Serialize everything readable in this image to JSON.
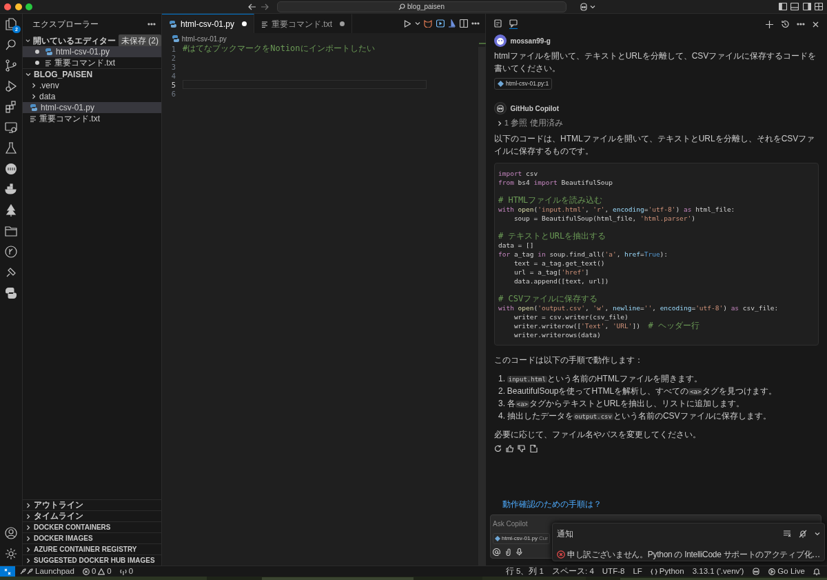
{
  "title_bar": {
    "search": "blog_paisen"
  },
  "activity_bar": {
    "explorer_badge": "2"
  },
  "sidebar": {
    "title": "エクスプローラー",
    "sections": [
      {
        "kind": "open_editors",
        "title": "開いているエディター",
        "expanded": true,
        "badge": "未保存 (2)",
        "items": [
          {
            "kind": "py",
            "label": "html-csv-01.py",
            "modified": true,
            "selected": true
          },
          {
            "kind": "txt",
            "label": "重要コマンド.txt",
            "modified": true,
            "selected": false
          }
        ]
      },
      {
        "kind": "folder",
        "title": "BLOG_PAISEN",
        "expanded": true,
        "items": [
          {
            "kind": "dir",
            "label": ".venv",
            "expanded": false,
            "selected": false
          },
          {
            "kind": "dir",
            "label": "data",
            "expanded": false,
            "selected": false
          },
          {
            "kind": "py",
            "label": "html-csv-01.py",
            "selected": true
          },
          {
            "kind": "txt",
            "label": "重要コマンド.txt",
            "selected": false
          }
        ]
      }
    ],
    "collapsed_sections": [
      {
        "title": "アウトライン",
        "expanded": false
      },
      {
        "title": "タイムライン",
        "expanded": false
      },
      {
        "title": "DOCKER CONTAINERS",
        "expanded": false
      },
      {
        "title": "DOCKER IMAGES",
        "expanded": false
      },
      {
        "title": "AZURE CONTAINER REGISTRY",
        "expanded": false
      },
      {
        "title": "SUGGESTED DOCKER HUB IMAGES",
        "expanded": false
      }
    ]
  },
  "editor": {
    "tabs": [
      {
        "kind": "py",
        "label": "html-csv-01.py",
        "modified": true,
        "selected": true
      },
      {
        "kind": "txt",
        "label": "重要コマンド.txt",
        "modified": true,
        "selected": false
      }
    ],
    "breadcrumb": "html-csv-01.py",
    "lines": [
      {
        "number": "1",
        "text": "#はてなブックマークをNotionにインポートしたい",
        "current": false
      },
      {
        "number": "2",
        "current": false
      },
      {
        "number": "3",
        "current": false
      },
      {
        "number": "4",
        "current": false
      },
      {
        "number": "5",
        "current": true
      },
      {
        "number": "6",
        "current": false
      }
    ]
  },
  "chat": {
    "tabs": [
      {
        "selected": false
      },
      {
        "selected": true
      }
    ],
    "user": {
      "name": "mossan99-g",
      "text": "htmlファイルを開いて、テキストとURLを分離して、CSVファイルに保存するコードを書いてください。",
      "reference": "html-csv-01.py:1"
    },
    "copilot": {
      "name": "GitHub Copilot",
      "references": "1 参照 使用済み",
      "references_expanded": false,
      "intro": "以下のコードは、HTMLファイルを開いて、テキストとURLを分離し、それをCSVファイルに保存するものです。",
      "code": [
        [
          [
            {
              "kind": "keyword",
              "text": "import "
            },
            {
              "kind": "plain",
              "text": "csv"
            }
          ],
          [
            {
              "kind": "keyword",
              "text": "from "
            },
            {
              "kind": "plain",
              "text": "bs4 "
            },
            {
              "kind": "keyword",
              "text": "import "
            },
            {
              "kind": "plain",
              "text": "BeautifulSoup"
            }
          ]
        ],
        [
          [
            {
              "kind": "comment",
              "text": "# HTMLファイルを読み込む"
            }
          ],
          [
            {
              "kind": "keyword",
              "text": "with "
            },
            {
              "kind": "function",
              "text": "open"
            },
            {
              "kind": "plain",
              "text": "("
            },
            {
              "kind": "string",
              "text": "'input.html'"
            },
            {
              "kind": "plain",
              "text": ", "
            },
            {
              "kind": "string",
              "text": "'r'"
            },
            {
              "kind": "plain",
              "text": ", "
            },
            {
              "kind": "param",
              "text": "encoding"
            },
            {
              "kind": "plain",
              "text": "="
            },
            {
              "kind": "string",
              "text": "'utf-8'"
            },
            {
              "kind": "plain",
              "text": ") "
            },
            {
              "kind": "keyword",
              "text": "as "
            },
            {
              "kind": "plain",
              "text": "html_file:"
            }
          ],
          [
            {
              "kind": "plain",
              "text": "    soup = BeautifulSoup(html_file, "
            },
            {
              "kind": "string",
              "text": "'html.parser'"
            },
            {
              "kind": "plain",
              "text": ")"
            }
          ]
        ],
        [
          [
            {
              "kind": "comment",
              "text": "# テキストとURLを抽出する"
            }
          ],
          [
            {
              "kind": "plain",
              "text": "data = []"
            }
          ],
          [
            {
              "kind": "keyword",
              "text": "for "
            },
            {
              "kind": "plain",
              "text": "a_tag "
            },
            {
              "kind": "keyword",
              "text": "in "
            },
            {
              "kind": "plain",
              "text": "soup.find_all("
            },
            {
              "kind": "string",
              "text": "'a'"
            },
            {
              "kind": "plain",
              "text": ", "
            },
            {
              "kind": "param",
              "text": "href"
            },
            {
              "kind": "plain",
              "text": "="
            },
            {
              "kind": "constant",
              "text": "True"
            },
            {
              "kind": "plain",
              "text": "):"
            }
          ],
          [
            {
              "kind": "plain",
              "text": "    text = a_tag.get_text()"
            }
          ],
          [
            {
              "kind": "plain",
              "text": "    url = a_tag["
            },
            {
              "kind": "string",
              "text": "'href'"
            },
            {
              "kind": "plain",
              "text": "]"
            }
          ],
          [
            {
              "kind": "plain",
              "text": "    data.append([text, url])"
            }
          ]
        ],
        [
          [
            {
              "kind": "comment",
              "text": "# CSVファイルに保存する"
            }
          ],
          [
            {
              "kind": "keyword",
              "text": "with "
            },
            {
              "kind": "function",
              "text": "open"
            },
            {
              "kind": "plain",
              "text": "("
            },
            {
              "kind": "string",
              "text": "'output.csv'"
            },
            {
              "kind": "plain",
              "text": ", "
            },
            {
              "kind": "string",
              "text": "'w'"
            },
            {
              "kind": "plain",
              "text": ", "
            },
            {
              "kind": "param",
              "text": "newline"
            },
            {
              "kind": "plain",
              "text": "="
            },
            {
              "kind": "string",
              "text": "''"
            },
            {
              "kind": "plain",
              "text": ", "
            },
            {
              "kind": "param",
              "text": "encoding"
            },
            {
              "kind": "plain",
              "text": "="
            },
            {
              "kind": "string",
              "text": "'utf-8'"
            },
            {
              "kind": "plain",
              "text": ") "
            },
            {
              "kind": "keyword",
              "text": "as "
            },
            {
              "kind": "plain",
              "text": "csv_file:"
            }
          ],
          [
            {
              "kind": "plain",
              "text": "    writer = csv.writer(csv_file)"
            }
          ],
          [
            {
              "kind": "plain",
              "text": "    writer.writerow(["
            },
            {
              "kind": "string",
              "text": "'Text'"
            },
            {
              "kind": "plain",
              "text": ", "
            },
            {
              "kind": "string",
              "text": "'URL'"
            },
            {
              "kind": "plain",
              "text": "])  "
            },
            {
              "kind": "comment",
              "text": "# ヘッダー行"
            }
          ],
          [
            {
              "kind": "plain",
              "text": "    writer.writerows(data)"
            }
          ]
        ]
      ],
      "steps_intro": "このコードは以下の手順で動作します：",
      "steps": [
        {
          "number": "1.",
          "parts": [
            {
              "text": "input.html",
              "code": true
            },
            {
              "text": "という名前のHTMLファイルを開きます。",
              "code": false
            }
          ]
        },
        {
          "number": "2.",
          "parts": [
            {
              "text": "BeautifulSoupを使ってHTMLを解析し、すべての",
              "code": false
            },
            {
              "text": "<a>",
              "code": true
            },
            {
              "text": "タグを見つけます。",
              "code": false
            }
          ]
        },
        {
          "number": "3.",
          "parts": [
            {
              "text": "各",
              "code": false
            },
            {
              "text": "<a>",
              "code": true
            },
            {
              "text": "タグからテキストとURLを抽出し、リストに追加します。",
              "code": false
            }
          ]
        },
        {
          "number": "4.",
          "parts": [
            {
              "text": "抽出したデータを",
              "code": false
            },
            {
              "text": "output.csv",
              "code": true
            },
            {
              "text": "という名前のCSVファイルに保存します。",
              "code": false
            }
          ]
        }
      ],
      "outro": "必要に応じて、ファイル名やパスを変更してください。"
    },
    "suggestion": "動作確認のための手順は？",
    "input": {
      "placeholder": "Ask Copilot",
      "chip": "html-csv-01.py",
      "chip_extra": "Cur"
    }
  },
  "notification": {
    "title": "通知",
    "error": true,
    "message": "申し訳ございません。Python の IntelliCode サポートのアクティブ化…"
  },
  "status_bar": {
    "left": [
      {
        "kind": "remote"
      },
      {
        "kind": "launchpad",
        "text": "Launchpad"
      },
      {
        "kind": "problems",
        "errors": "0",
        "warnings": "0"
      },
      {
        "kind": "ports",
        "text": "0"
      }
    ],
    "right": [
      {
        "kind": "text",
        "text": "行 5、列 1"
      },
      {
        "kind": "text",
        "text": "スペース: 4"
      },
      {
        "kind": "text",
        "text": "UTF-8"
      },
      {
        "kind": "text",
        "text": "LF"
      },
      {
        "kind": "language",
        "text": "Python"
      },
      {
        "kind": "text",
        "text": "3.13.1 ('.venv')"
      },
      {
        "kind": "copilot"
      },
      {
        "kind": "golive",
        "text": "Go Live"
      },
      {
        "kind": "bell"
      }
    ]
  }
}
